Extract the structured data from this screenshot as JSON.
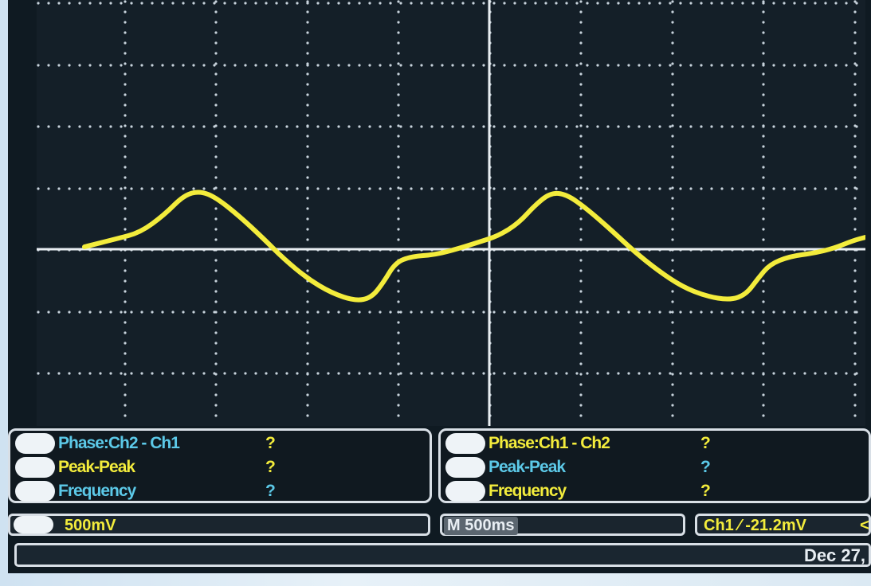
{
  "colors": {
    "ch1": "#f3ec3c",
    "ch2": "#5cc9e8",
    "grid": "#c8d3dc",
    "background": "#141f28"
  },
  "waveform": {
    "channel": "Ch1",
    "color": "#f3ec3c"
  },
  "left_panel": {
    "rows": [
      {
        "label": "Phase:Ch2 - Ch1",
        "value": "?",
        "color": "cyan",
        "value_color": "yellow"
      },
      {
        "label": "Peak-Peak",
        "value": "?",
        "color": "yellow",
        "value_color": "yellow"
      },
      {
        "label": "Frequency",
        "value": "?",
        "color": "cyan",
        "value_color": "cyan"
      }
    ]
  },
  "right_panel": {
    "rows": [
      {
        "label": "Phase:Ch1 - Ch2",
        "value": "?",
        "color": "yellow",
        "value_color": "yellow"
      },
      {
        "label": "Peak-Peak",
        "value": "?",
        "color": "cyan",
        "value_color": "cyan"
      },
      {
        "label": "Frequency",
        "value": "?",
        "color": "yellow",
        "value_color": "yellow"
      }
    ]
  },
  "status": {
    "volts_div": "500mV",
    "timebase": "M 500ms",
    "trigger": "Ch1 ⁄ -21.2mV",
    "trigger_arrow": "<"
  },
  "date": "Dec 27,"
}
